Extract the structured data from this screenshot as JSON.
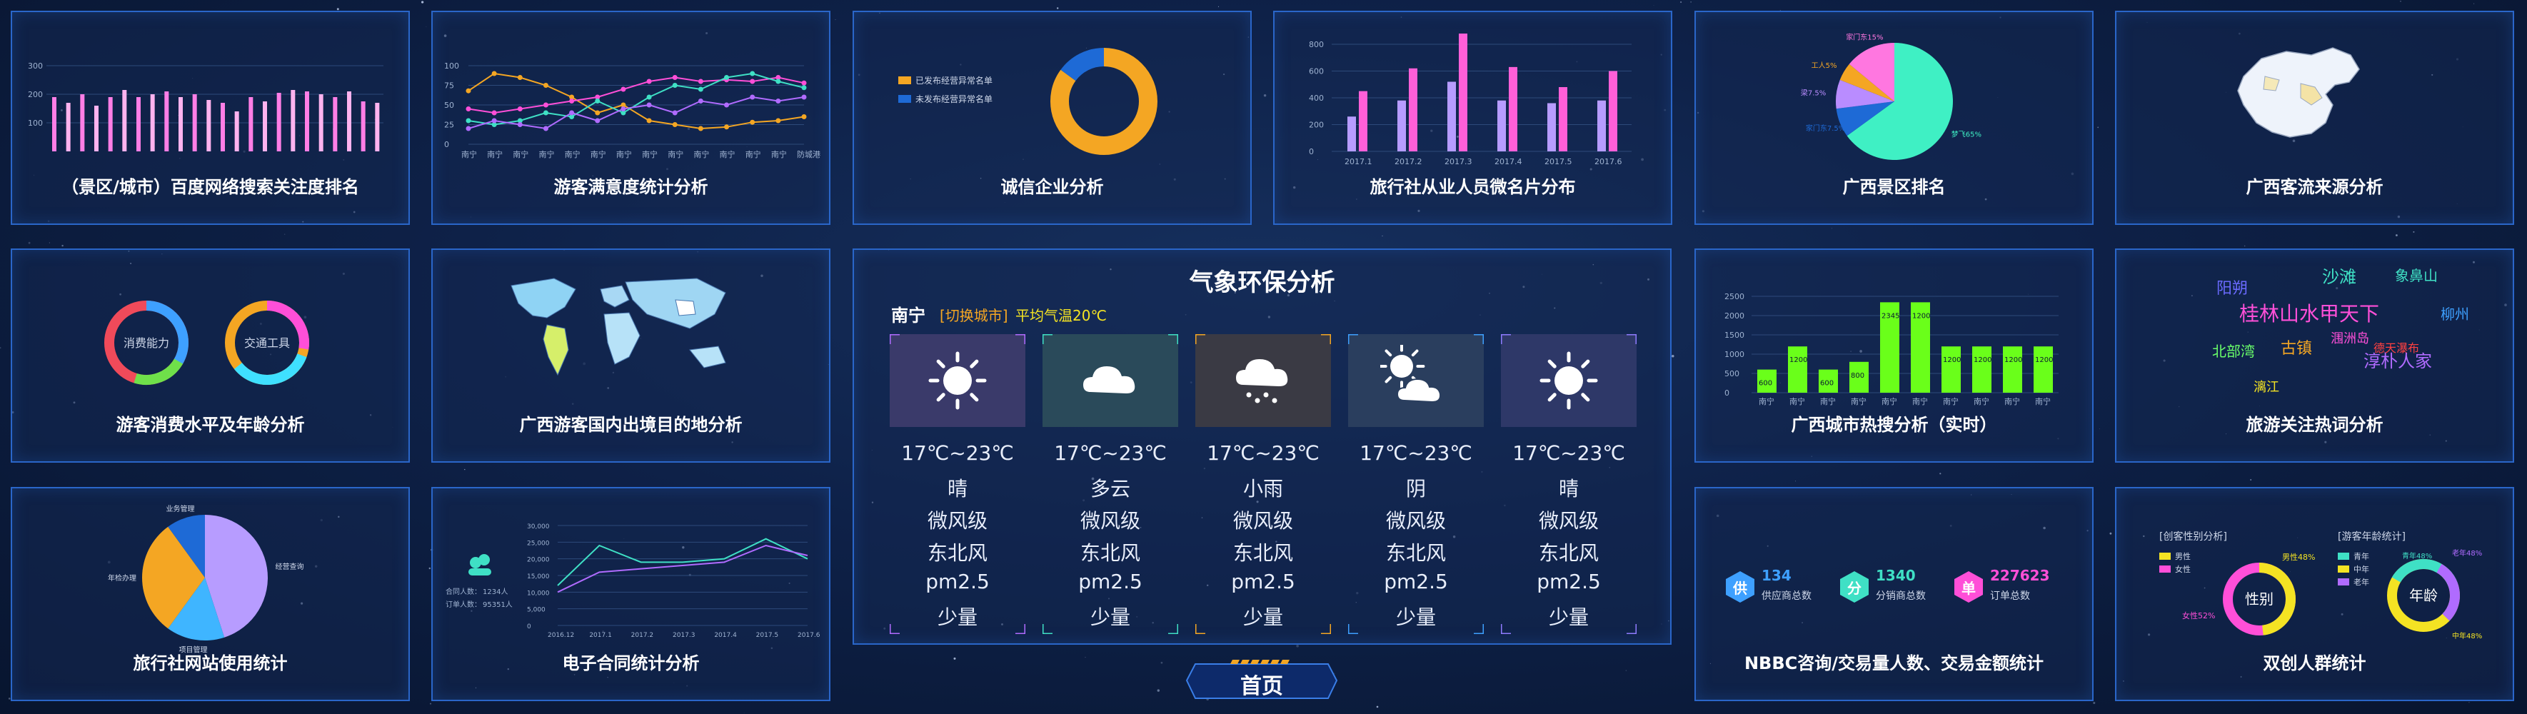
{
  "panels": {
    "search_rank": {
      "title": "（景区/城市）百度网络搜索关注度排名",
      "yticks": [
        "300",
        "200",
        "100"
      ],
      "values": [
        190,
        170,
        200,
        160,
        190,
        215,
        190,
        200,
        210,
        190,
        200,
        180,
        170,
        140,
        190,
        175,
        205,
        215,
        210,
        200,
        190,
        210,
        175,
        170
      ]
    },
    "satisfaction": {
      "title": "游客满意度统计分析",
      "yticks": [
        "100",
        "75",
        "50",
        "25",
        "0"
      ],
      "xticks": [
        "南宁",
        "南宁",
        "南宁",
        "南宁",
        "南宁",
        "南宁",
        "南宁",
        "南宁",
        "南宁",
        "南宁",
        "南宁",
        "南宁",
        "南宁",
        "防城港"
      ],
      "series": [
        {
          "color": "#f4a623",
          "values": [
            68,
            90,
            85,
            75,
            60,
            40,
            50,
            30,
            25,
            20,
            22,
            28,
            30,
            35
          ]
        },
        {
          "color": "#ff4fd8",
          "values": [
            45,
            40,
            45,
            50,
            55,
            60,
            70,
            80,
            85,
            80,
            82,
            80,
            85,
            78
          ]
        },
        {
          "color": "#3fe0c5",
          "values": [
            30,
            25,
            30,
            40,
            35,
            55,
            40,
            60,
            75,
            70,
            85,
            90,
            80,
            72
          ]
        },
        {
          "color": "#b06bff",
          "values": [
            20,
            30,
            25,
            20,
            40,
            30,
            45,
            50,
            40,
            55,
            50,
            60,
            55,
            60
          ]
        }
      ]
    },
    "credit": {
      "title": "诚信企业分析",
      "legend": [
        "已发布经营异常名单",
        "未发布经营异常名单"
      ],
      "colors": [
        "#f4a623",
        "#1e6ad6"
      ],
      "values": [
        85,
        15
      ]
    },
    "agency_staff": {
      "title": "旅行社从业人员微名片分布",
      "yticks": [
        "800",
        "600",
        "400",
        "200",
        "0"
      ],
      "xticks": [
        "2017.1",
        "2017.2",
        "2017.3",
        "2017.4",
        "2017.5",
        "2017.6"
      ],
      "series": [
        {
          "color": "#b79cff",
          "values": [
            260,
            380,
            520,
            380,
            360,
            380
          ]
        },
        {
          "color": "#ff5fd8",
          "values": [
            450,
            620,
            880,
            630,
            480,
            600
          ]
        }
      ]
    },
    "scenic_rank": {
      "title": "广西景区排名",
      "slices": [
        {
          "label": "梦飞65%",
          "value": 65,
          "color": "#3ff0c4"
        },
        {
          "label": "家门东7.5%",
          "value": 8,
          "color": "#1e6ad6"
        },
        {
          "label": "梁7.5%",
          "value": 8,
          "color": "#b98cff"
        },
        {
          "label": "工人5%",
          "value": 5,
          "color": "#f4a623"
        },
        {
          "label": "家门东15%",
          "value": 14,
          "color": "#ff77e0"
        }
      ]
    },
    "tourist_source": {
      "title": "广西客流来源分析"
    },
    "consumption": {
      "title": "游客消费水平及年龄分析",
      "rings": [
        "消费能力",
        "交通工具"
      ]
    },
    "destination": {
      "title": "广西游客国内出境目的地分析"
    },
    "weather": {
      "title": "气象环保分析",
      "city": "南宁",
      "switch_label": "[切换城市]",
      "avg_temp": "平均气温20℃",
      "days": [
        {
          "icon": "sun-icon",
          "temp": "17℃~23℃",
          "sky": "晴",
          "wind_level": "微风级",
          "wind_dir": "东北风",
          "pm": "pm2.5",
          "amount": "少量",
          "bg": "#3a3a6a",
          "corner": "#b06bff"
        },
        {
          "icon": "cloud-icon",
          "temp": "17℃~23℃",
          "sky": "多云",
          "wind_level": "微风级",
          "wind_dir": "东北风",
          "pm": "pm2.5",
          "amount": "少量",
          "bg": "#2a4a5a",
          "corner": "#3fe0c5"
        },
        {
          "icon": "rain-cloud-icon",
          "temp": "17℃~23℃",
          "sky": "小雨",
          "wind_level": "微风级",
          "wind_dir": "东北风",
          "pm": "pm2.5",
          "amount": "少量",
          "bg": "#3a3a44",
          "corner": "#f4a623"
        },
        {
          "icon": "sun-cloud-icon",
          "temp": "17℃~23℃",
          "sky": "阴",
          "wind_level": "微风级",
          "wind_dir": "东北风",
          "pm": "pm2.5",
          "amount": "少量",
          "bg": "#2a3e5e",
          "corner": "#3ea0ff"
        },
        {
          "icon": "sun-icon",
          "temp": "17℃~23℃",
          "sky": "晴",
          "wind_level": "微风级",
          "wind_dir": "东北风",
          "pm": "pm2.5",
          "amount": "少量",
          "bg": "#2e3868",
          "corner": "#8f7bff"
        }
      ]
    },
    "city_heat": {
      "title": "广西城市热搜分析（实时）",
      "yticks": [
        "2500",
        "2000",
        "1500",
        "1000",
        "500",
        "0"
      ],
      "xticks": [
        "南宁",
        "南宁",
        "南宁",
        "南宁",
        "南宁",
        "南宁",
        "南宁",
        "南宁",
        "南宁",
        "南宁"
      ],
      "values": [
        600,
        1200,
        600,
        800,
        2345,
        2345,
        1200,
        1200,
        1200,
        1200
      ],
      "labels": [
        "600",
        "1200",
        "600",
        "800",
        "2345",
        "1200",
        "1200",
        "1200",
        "1200",
        "1200"
      ]
    },
    "hot_words": {
      "title": "旅游关注热词分析",
      "words": [
        {
          "text": "阳朔",
          "color": "#6a6aff"
        },
        {
          "text": "沙滩",
          "color": "#3fe0c5"
        },
        {
          "text": "象鼻山",
          "color": "#3fe0c5"
        },
        {
          "text": "桂林山水甲天下",
          "color": "#ff4fd8"
        },
        {
          "text": "柳州",
          "color": "#3ea0ff"
        },
        {
          "text": "北部湾",
          "color": "#6aff6a"
        },
        {
          "text": "古镇",
          "color": "#f4a623"
        },
        {
          "text": "涠洲岛",
          "color": "#ff4fd8"
        },
        {
          "text": "淳朴人家",
          "color": "#b06bff"
        },
        {
          "text": "漓江",
          "color": "#f4e323"
        },
        {
          "text": "德天瀑布",
          "color": "#ff4040"
        }
      ]
    },
    "website_usage": {
      "title": "旅行社网站使用统计",
      "slices": [
        {
          "label": "经营查询",
          "value": 45,
          "color": "#b79cff"
        },
        {
          "label": "项目管理",
          "value": 15,
          "color": "#3fb5ff"
        },
        {
          "label": "年检办理",
          "value": 30,
          "color": "#f4a623"
        },
        {
          "label": "业务管理",
          "value": 10,
          "color": "#1e6ad6"
        }
      ]
    },
    "contracts": {
      "title": "电子合同统计分析",
      "people_label": "合同人数：",
      "people_value": "1234人",
      "orders_label": "订单人数：",
      "orders_value": "95351人",
      "yticks": [
        "30,000",
        "25,000",
        "20,000",
        "15,000",
        "10,000",
        "5,000",
        "0"
      ],
      "xticks": [
        "2016.12",
        "2017.1",
        "2017.2",
        "2017.3",
        "2017.4",
        "2017.5",
        "2017.6"
      ],
      "series": [
        {
          "color": "#3fe0c5",
          "values": [
            12000,
            24000,
            19000,
            19000,
            20000,
            26000,
            20000
          ]
        },
        {
          "color": "#b06bff",
          "values": [
            10000,
            16000,
            17000,
            18000,
            19000,
            24000,
            21000
          ]
        }
      ]
    },
    "nbbc": {
      "title": "NBBC咨询/交易量人数、交易金额统计",
      "items": [
        {
          "badge": "供",
          "value": "134",
          "label": "供应商总数",
          "color": "#3ea0ff"
        },
        {
          "badge": "分",
          "value": "1340",
          "label": "分销商总数",
          "color": "#3fe0c5"
        },
        {
          "badge": "单",
          "value": "227623",
          "label": "订单总数",
          "color": "#ff4fd8"
        }
      ]
    },
    "demographics": {
      "title": "双创人群统计",
      "gender_heading": "[创客性别分析]",
      "age_heading": "[游客年龄统计]",
      "gender_center": "性别",
      "age_center": "年龄",
      "gender_legend": [
        "男性",
        "女性"
      ],
      "age_legend": [
        "青年",
        "中年",
        "老年"
      ],
      "gender_tags": [
        "男性48%",
        "女性52%"
      ],
      "age_tags": [
        "老年48%",
        "青年48%",
        "中年48%"
      ]
    }
  },
  "nav": {
    "home_label": "首页"
  }
}
